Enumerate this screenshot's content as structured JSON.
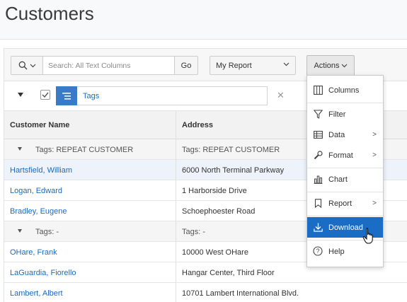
{
  "page": {
    "title": "Customers"
  },
  "toolbar": {
    "search_placeholder": "Search: All Text Columns",
    "go_label": "Go",
    "report_label": "My Report",
    "actions_label": "Actions"
  },
  "filter": {
    "label": "Tags"
  },
  "table": {
    "headers": {
      "name": "Customer Name",
      "address": "Address"
    },
    "groups": [
      {
        "label": "Tags: REPEAT CUSTOMER",
        "label_address": "Tags: REPEAT CUSTOMER",
        "rows": [
          {
            "name": "Hartsfield, William",
            "address": "6000 North Terminal Parkway"
          },
          {
            "name": "Logan, Edward",
            "address": "1 Harborside Drive"
          },
          {
            "name": "Bradley, Eugene",
            "address": "Schoephoester Road"
          }
        ]
      },
      {
        "label": "Tags: -",
        "label_address": "Tags: -",
        "rows": [
          {
            "name": "OHare, Frank",
            "address": "10000 West OHare"
          },
          {
            "name": "LaGuardia, Fiorello",
            "address": "Hangar Center, Third Floor"
          },
          {
            "name": "Lambert, Albert",
            "address": "10701 Lambert International Blvd."
          }
        ]
      }
    ]
  },
  "actions_menu": {
    "columns": "Columns",
    "filter": "Filter",
    "data": "Data",
    "format": "Format",
    "chart": "Chart",
    "report": "Report",
    "download": "Download",
    "help": "Help",
    "highlighted": "Download"
  },
  "colors": {
    "accent": "#1a6cc4",
    "link": "#1a6ac0",
    "filter_icon_bg": "#3a7bc8"
  }
}
